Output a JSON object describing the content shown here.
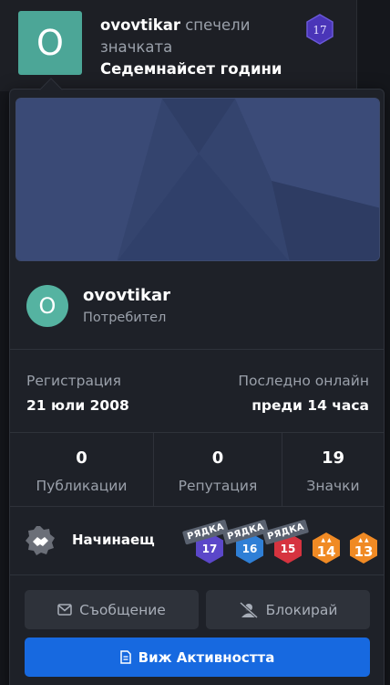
{
  "feed": {
    "avatar_letter": "O",
    "username": "ovovtikar",
    "action": "спечели значката",
    "badge_name": "Седемнайсет години",
    "badge_level": "17"
  },
  "card": {
    "avatar_letter": "O",
    "username": "ovovtikar",
    "role": "Потребител",
    "registration_label": "Регистрация",
    "registration_value": "21 юли 2008",
    "last_online_label": "Последно онлайн",
    "last_online_value": "преди 14 часа",
    "stats": [
      {
        "value": "0",
        "label": "Публикации"
      },
      {
        "value": "0",
        "label": "Репутация"
      },
      {
        "value": "19",
        "label": "Значки"
      }
    ],
    "rank": {
      "label": "Начинаещ",
      "icon": "handshake-icon"
    },
    "badges": [
      {
        "level": "17",
        "ribbon": "РЯДКА",
        "color": "#5b47c9"
      },
      {
        "level": "16",
        "ribbon": "РЯДКА",
        "color": "#2f7fd6"
      },
      {
        "level": "15",
        "ribbon": "РЯДКА",
        "color": "#d6333f"
      },
      {
        "level": "14",
        "ribbon": "",
        "color": "#f08a24"
      },
      {
        "level": "13",
        "ribbon": "",
        "color": "#f08a24"
      }
    ],
    "buttons": {
      "message": "Съобщение",
      "block": "Блокирай",
      "activity": "Виж Активността"
    }
  },
  "colors": {
    "accent": "#1769e0",
    "avatar": "#55b3a1",
    "cover": "#34446e"
  }
}
